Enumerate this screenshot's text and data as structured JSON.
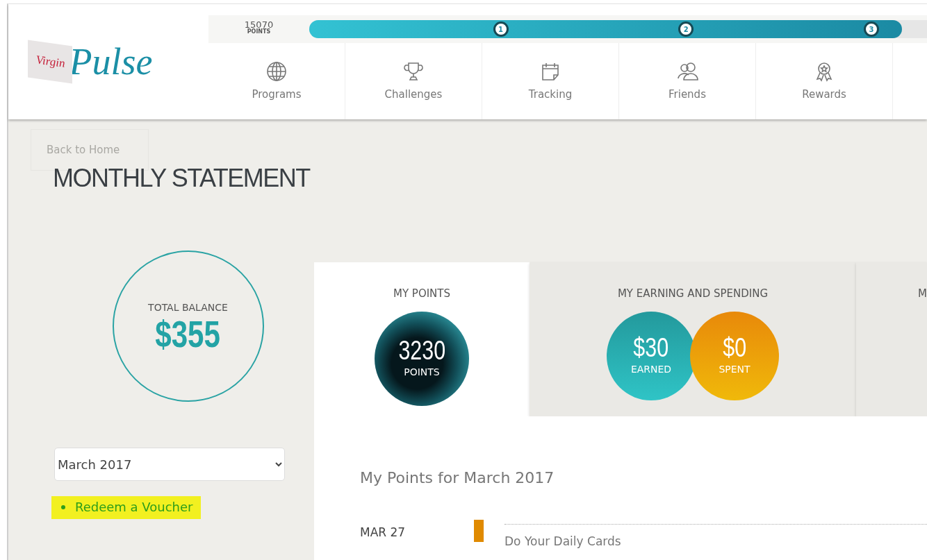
{
  "header": {
    "logo": {
      "small": "Virgin",
      "large": "Pulse"
    },
    "progress": {
      "points": "15070",
      "unit": "POINTS",
      "level": 0.96,
      "milestones": [
        "1",
        "2",
        "3"
      ]
    },
    "nav": [
      {
        "label": "Programs",
        "kind": "globe"
      },
      {
        "label": "Challenges",
        "kind": "trophy"
      },
      {
        "label": "Tracking",
        "kind": "calendar"
      },
      {
        "label": "Friends",
        "kind": "people"
      },
      {
        "label": "Rewards",
        "kind": "medal"
      }
    ]
  },
  "back_button": "Back to Home",
  "title": "MONTHLY STATEMENT",
  "balance": {
    "label": "TOTAL BALANCE",
    "value": "$355"
  },
  "month_select": {
    "value": "March 2017"
  },
  "links": [
    {
      "label": "Redeem a Voucher",
      "highlighted": true
    }
  ],
  "tabs": [
    {
      "label": "MY POINTS",
      "selected": true,
      "circles": [
        {
          "kind": "points",
          "value": "3230",
          "caption": "POINTS"
        }
      ]
    },
    {
      "label": "MY EARNING AND SPENDING",
      "selected": false,
      "circles": [
        {
          "kind": "earned",
          "value": "$30",
          "caption": "EARNED"
        },
        {
          "kind": "spent",
          "value": "$0",
          "caption": "SPENT"
        }
      ]
    },
    {
      "label": "M",
      "selected": false
    }
  ],
  "points_heading": "My Points for March 2017",
  "entries": [
    {
      "date": "MAR 27",
      "activity": "Do Your Daily Cards",
      "color": "#e08a00"
    }
  ]
}
